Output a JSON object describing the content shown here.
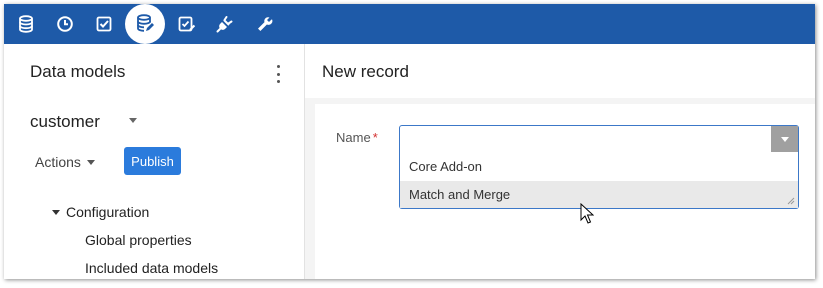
{
  "toolbar": {
    "icons": [
      "database-icon",
      "clock-icon",
      "checkbox-icon",
      "data-model-icon",
      "edit-check-icon",
      "plug-icon",
      "wrench-icon"
    ],
    "active_icon": "data-model-icon"
  },
  "left_panel": {
    "title": "Data models",
    "model_name": "customer",
    "actions_label": "Actions",
    "publish_label": "Publish",
    "tree": {
      "root": "Configuration",
      "children": [
        "Global properties",
        "Included data models"
      ]
    }
  },
  "right_panel": {
    "title": "New record",
    "form": {
      "name_label": "Name",
      "required_marker": "*",
      "name_value": "",
      "options": [
        "Core Add-on",
        "Match and Merge"
      ],
      "highlighted_option": "Match and Merge"
    }
  },
  "colors": {
    "toolbar_bg": "#1e5aa8",
    "publish_bg": "#2b7bdc",
    "focus_border": "#3c78c8",
    "required": "#d32f2f"
  }
}
